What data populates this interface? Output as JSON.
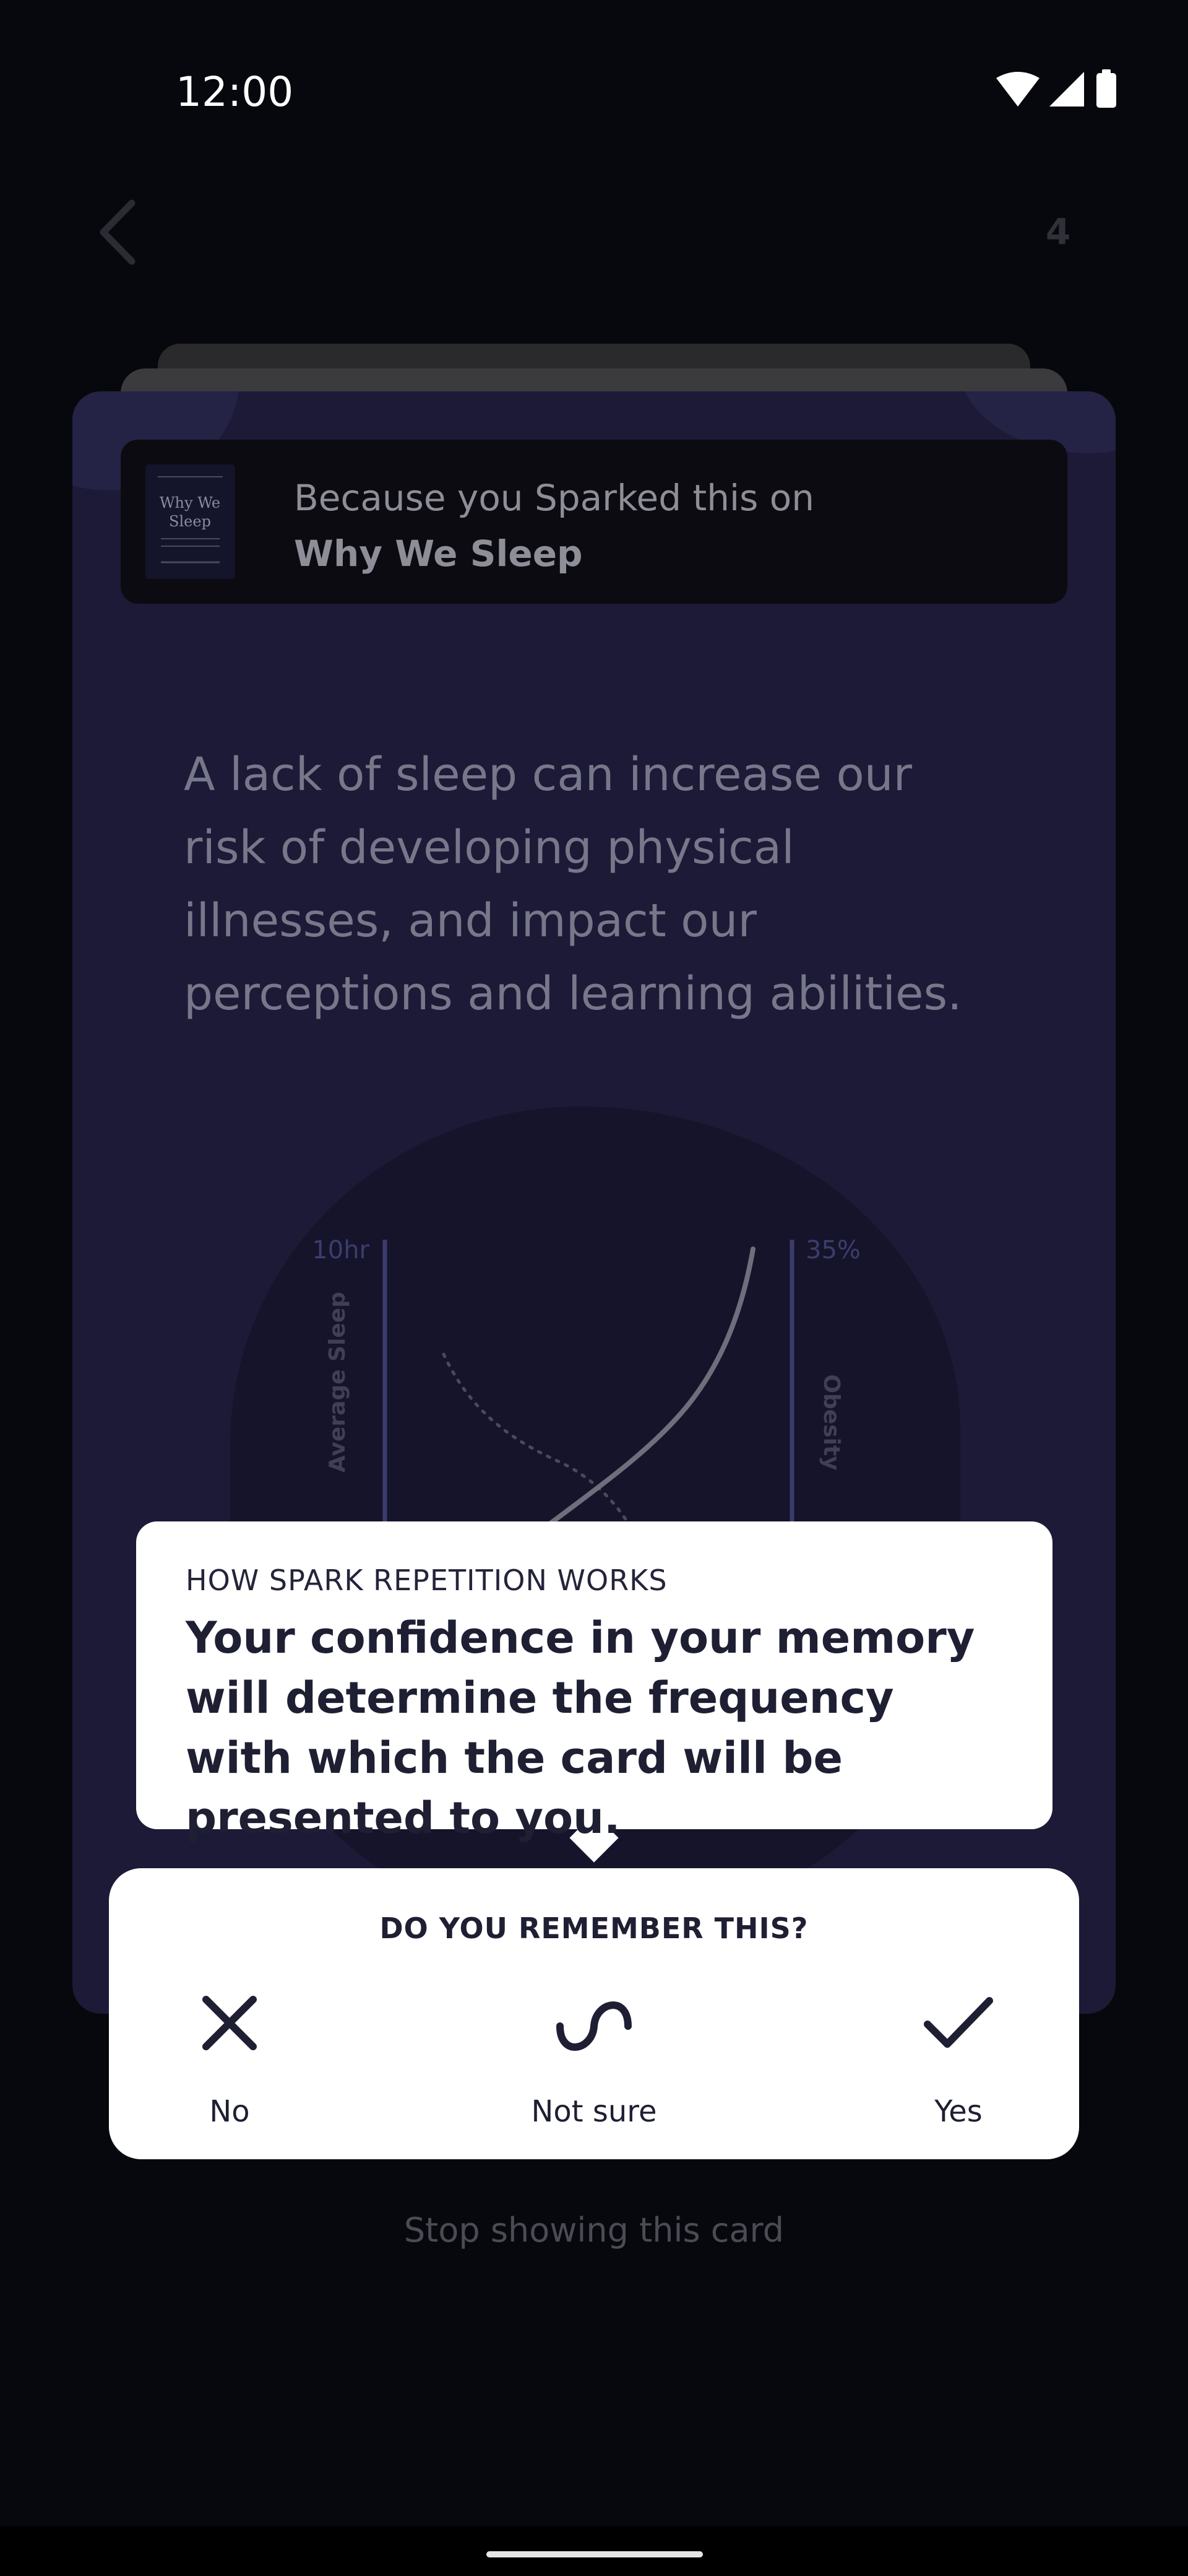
{
  "status_bar": {
    "time": "12:00",
    "icons": [
      "wifi-icon",
      "cellular-icon",
      "battery-icon"
    ]
  },
  "nav": {
    "back_icon": "chevron-left-icon",
    "counter": "4"
  },
  "card": {
    "because_line1": "Because you Sparked this on",
    "book_title": "Why We Sleep",
    "cover_lines": [
      "Why We",
      "Sleep"
    ],
    "text": "A lack of sleep can increase our risk of developing physical illnesses, and impact our perceptions and learning abilities."
  },
  "chart_data": {
    "type": "line",
    "title": "",
    "left_axis": {
      "label": "Average Sleep",
      "max_label": "10hr"
    },
    "right_axis": {
      "label": "Obesity",
      "max_label": "35%"
    },
    "series": [
      {
        "name": "Average Sleep",
        "style": "dotted",
        "trend": "decreasing"
      },
      {
        "name": "Obesity",
        "style": "solid",
        "trend": "increasing"
      }
    ]
  },
  "tooltip": {
    "kicker": "HOW SPARK REPETITION WORKS",
    "body": "Your confidence in your memory will determine the frequency with which the card will be presented to you."
  },
  "panel": {
    "title": "DO YOU REMEMBER THIS?",
    "options": [
      {
        "label": "No",
        "icon": "x-icon"
      },
      {
        "label": "Not sure",
        "icon": "wave-icon"
      },
      {
        "label": "Yes",
        "icon": "check-icon"
      }
    ]
  },
  "footer": {
    "stop_label": "Stop showing this card"
  },
  "colors": {
    "background": "#07080d",
    "card": "#1c1a37",
    "panel": "#ffffff",
    "text_dark": "#1e1f33"
  }
}
